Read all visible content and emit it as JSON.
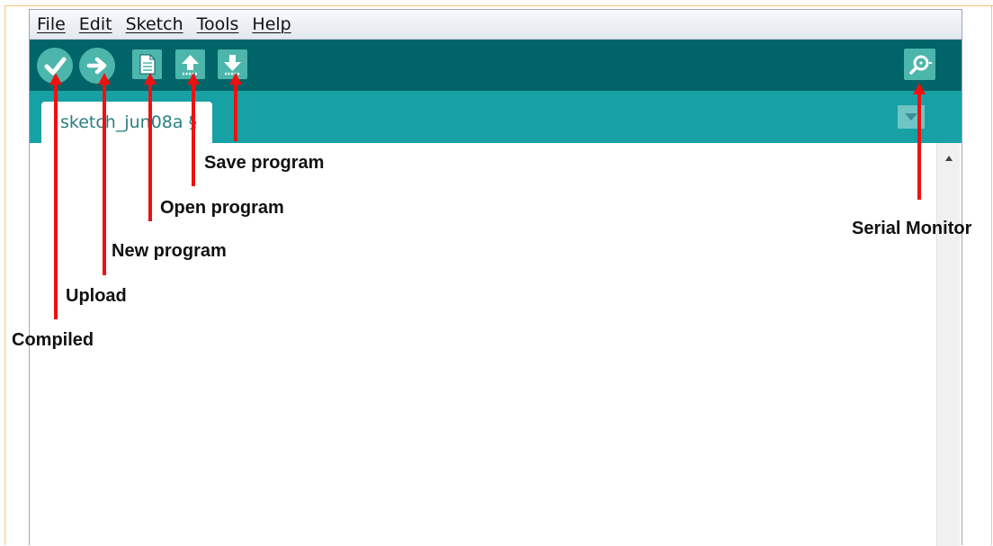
{
  "menu": {
    "items": [
      "File",
      "Edit",
      "Sketch",
      "Tools",
      "Help"
    ]
  },
  "toolbar": {
    "buttons": [
      {
        "name": "verify",
        "icon": "checkmark-icon"
      },
      {
        "name": "upload",
        "icon": "arrow-right-icon"
      },
      {
        "name": "new",
        "icon": "new-file-icon"
      },
      {
        "name": "open",
        "icon": "open-up-arrow-icon"
      },
      {
        "name": "save",
        "icon": "save-down-arrow-icon"
      },
      {
        "name": "serial-monitor",
        "icon": "magnifier-icon"
      }
    ]
  },
  "tab": {
    "label": "sketch_jun08a §"
  },
  "annotations": {
    "compiled": "Compiled",
    "upload": "Upload",
    "new_program": "New program",
    "open_program": "Open program",
    "save_program": "Save program",
    "serial_monitor": "Serial Monitor"
  },
  "colors": {
    "toolbar": "#006468",
    "tabbar": "#17a1a5",
    "button": "#4db6ac",
    "arrow": "#ee1111",
    "border": "#f5c47a"
  }
}
